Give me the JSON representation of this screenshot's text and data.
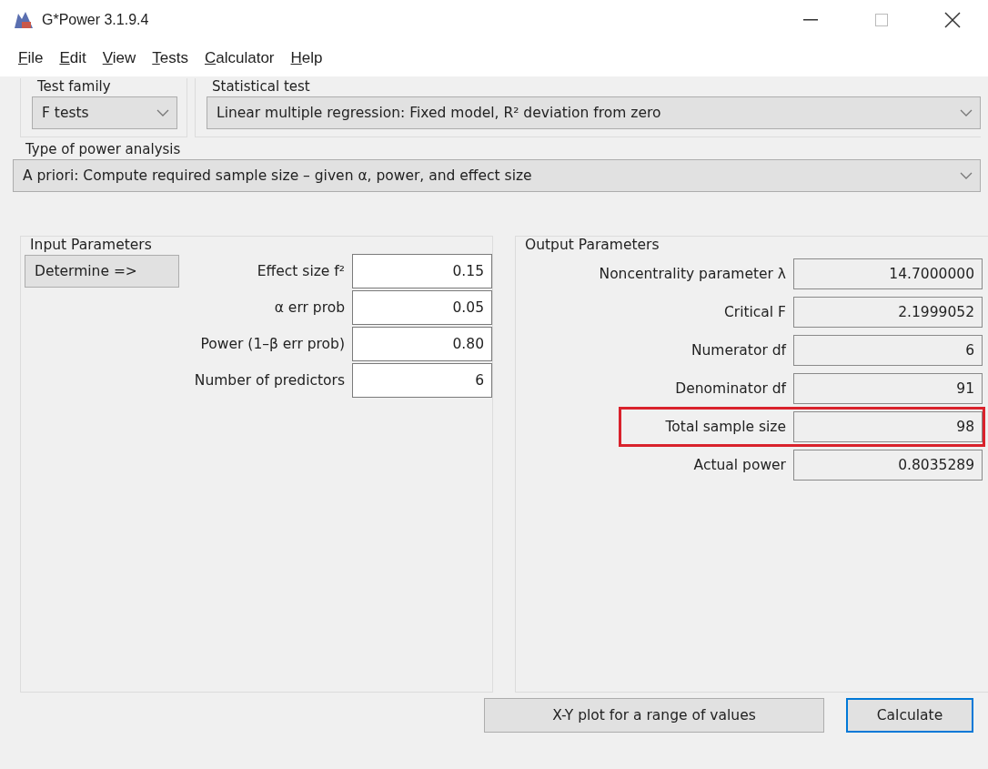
{
  "window": {
    "title": "G*Power 3.1.9.4"
  },
  "menu": [
    "File",
    "Edit",
    "View",
    "Tests",
    "Calculator",
    "Help"
  ],
  "test_family": {
    "label": "Test family",
    "value": "F tests"
  },
  "statistical_test": {
    "label": "Statistical test",
    "value": "Linear multiple regression: Fixed model, R² deviation from zero"
  },
  "power_analysis": {
    "label": "Type of power analysis",
    "value": "A priori: Compute required sample size – given α, power, and effect size"
  },
  "input_parameters": {
    "title": "Input Parameters",
    "determine_button": "Determine =>",
    "fields": [
      {
        "label": "Effect size f²",
        "value": "0.15"
      },
      {
        "label": "α err prob",
        "value": "0.05"
      },
      {
        "label": "Power (1–β err prob)",
        "value": "0.80"
      },
      {
        "label": "Number of predictors",
        "value": "6"
      }
    ]
  },
  "output_parameters": {
    "title": "Output Parameters",
    "fields": [
      {
        "label": "Noncentrality parameter λ",
        "value": "14.7000000",
        "highlighted": false
      },
      {
        "label": "Critical F",
        "value": "2.1999052",
        "highlighted": false
      },
      {
        "label": "Numerator df",
        "value": "6",
        "highlighted": false
      },
      {
        "label": "Denominator df",
        "value": "91",
        "highlighted": false
      },
      {
        "label": "Total sample size",
        "value": "98",
        "highlighted": true
      },
      {
        "label": "Actual power",
        "value": "0.8035289",
        "highlighted": false
      }
    ]
  },
  "buttons": [
    {
      "label": "X-Y plot for a range of values",
      "focused": false
    },
    {
      "label": "Calculate",
      "focused": true
    }
  ]
}
